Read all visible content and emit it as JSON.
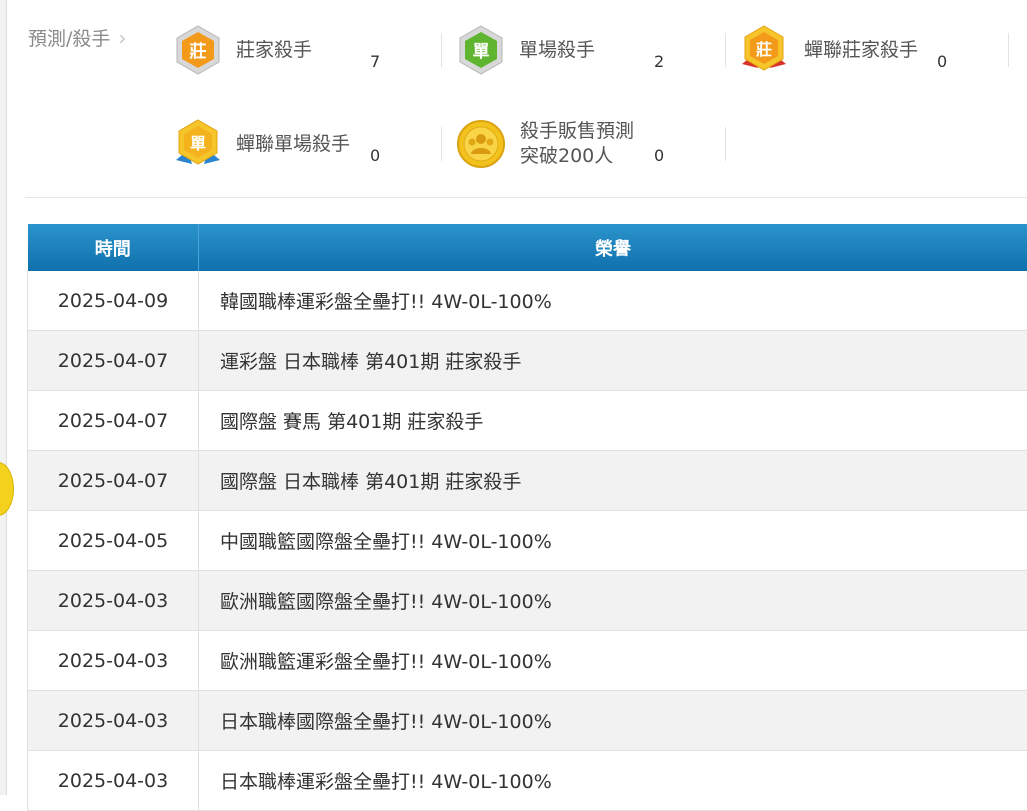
{
  "breadcrumb": {
    "label": "預測/殺手"
  },
  "awards": [
    {
      "label": "莊家殺手",
      "count": "7",
      "icon": "zhuang-hexagon-badge-icon",
      "badge_char": "莊",
      "color": "#f39a1b"
    },
    {
      "label": "單場殺手",
      "count": "2",
      "icon": "dan-hexagon-badge-icon",
      "badge_char": "單",
      "color": "#5fb52f"
    },
    {
      "label": "蟬聯莊家殺手",
      "count": "0",
      "icon": "zhuang-ribbon-badge-icon",
      "badge_char": "莊",
      "color": "#f39a1b"
    },
    {
      "label": "蟬聯單場殺手",
      "count": "0",
      "icon": "dan-ribbon-badge-icon",
      "badge_char": "單",
      "color": "#f4c21c"
    },
    {
      "label_line1": "殺手販售預測",
      "label_line2": "突破200人",
      "count": "0",
      "icon": "gold-coin-people-icon",
      "color": "#f4c21c"
    }
  ],
  "table": {
    "headers": {
      "time": "時間",
      "honor": "榮譽"
    },
    "rows": [
      {
        "date": "2025-04-09",
        "honor": "韓國職棒運彩盤全壘打!! 4W-0L-100%"
      },
      {
        "date": "2025-04-07",
        "honor": "運彩盤 日本職棒 第401期 莊家殺手"
      },
      {
        "date": "2025-04-07",
        "honor": "國際盤 賽馬 第401期 莊家殺手"
      },
      {
        "date": "2025-04-07",
        "honor": "國際盤 日本職棒 第401期 莊家殺手"
      },
      {
        "date": "2025-04-05",
        "honor": "中國職籃國際盤全壘打!! 4W-0L-100%"
      },
      {
        "date": "2025-04-03",
        "honor": "歐洲職籃國際盤全壘打!! 4W-0L-100%"
      },
      {
        "date": "2025-04-03",
        "honor": "歐洲職籃運彩盤全壘打!! 4W-0L-100%"
      },
      {
        "date": "2025-04-03",
        "honor": "日本職棒國際盤全壘打!! 4W-0L-100%"
      },
      {
        "date": "2025-04-03",
        "honor": "日本職棒運彩盤全壘打!! 4W-0L-100%"
      }
    ]
  }
}
